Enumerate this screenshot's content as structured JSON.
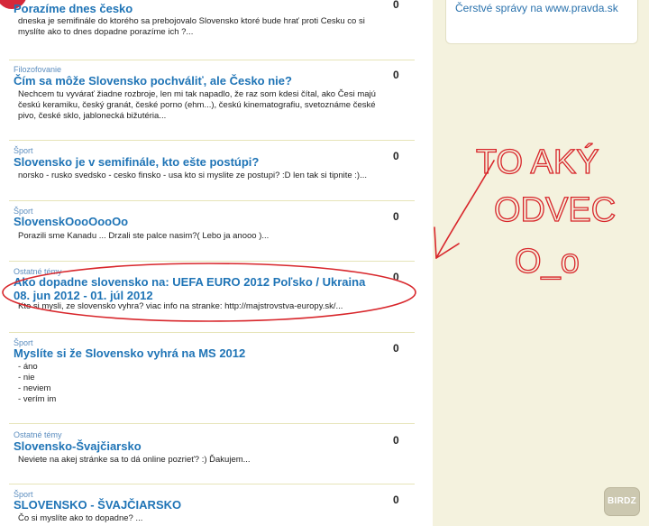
{
  "sidebar": {
    "news_link": "Čerstvé správy na www.pravda.sk"
  },
  "posts": [
    {
      "category": "",
      "title": "Porazíme dnes česko",
      "count": "0",
      "excerpt": "dneska je semifinále do ktorého sa prebojovalo Slovensko ktoré bude hrať proti Cesku co si myslíte ako to dnes dopadne porazíme ich ?..."
    },
    {
      "category": "Filozofovanie",
      "title": "Čím sa môže Slovensko pochváliť, ale Česko nie?",
      "count": "0",
      "excerpt": "Nechcem tu vyvárať žiadne rozbroje, len mi tak napadlo, že raz som kdesi čítal, ako Česi majú českú keramiku, český granát, české porno (ehm...), českú kinematografiu, svetoznáme české pivo, české sklo, jablonecká bižutéria..."
    },
    {
      "category": "Šport",
      "title": "Slovensko je v semifinále, kto ešte postúpi?",
      "count": "0",
      "excerpt": "norsko - rusko svedsko - cesko finsko - usa kto si myslite ze postupi? :D len tak si tipnite :)..."
    },
    {
      "category": "Šport",
      "title": "SlovenskOooOooOo",
      "count": "0",
      "excerpt": "Porazili sme Kanadu ... Drzali ste palce nasim?( Lebo ja anooo )..."
    },
    {
      "category": "Ostatné témy",
      "title": "Ako dopadne slovensko na: UEFA EURO 2012 Poľsko / Ukraina 08. jun 2012 - 01. júl 2012",
      "count": "0",
      "excerpt": "Kto si mysli, ze slovensko vyhra? viac info na stranke: http://majstrovstva-europy.sk/..."
    },
    {
      "category": "Šport",
      "title": "Myslíte si že Slovensko vyhrá na MS 2012",
      "count": "0",
      "options": [
        "áno",
        "nie",
        "neviem",
        "verím im"
      ]
    },
    {
      "category": "Ostatné témy",
      "title": "Slovensko-Švajčiarsko",
      "count": "0",
      "excerpt": "Neviete na akej stránke sa to dá online pozrieť? :) Ďakujem..."
    },
    {
      "category": "Šport",
      "title": "SLOVENSKO - ŠVAJČIARSKO",
      "count": "0",
      "excerpt": "Čo si myslíte ako to dopadne? ..."
    }
  ],
  "annotation": {
    "lines": [
      "TO AKÝ",
      "ODVEC",
      "O_o"
    ],
    "color": "#d8262b"
  },
  "watermark": "BIRDZ"
}
